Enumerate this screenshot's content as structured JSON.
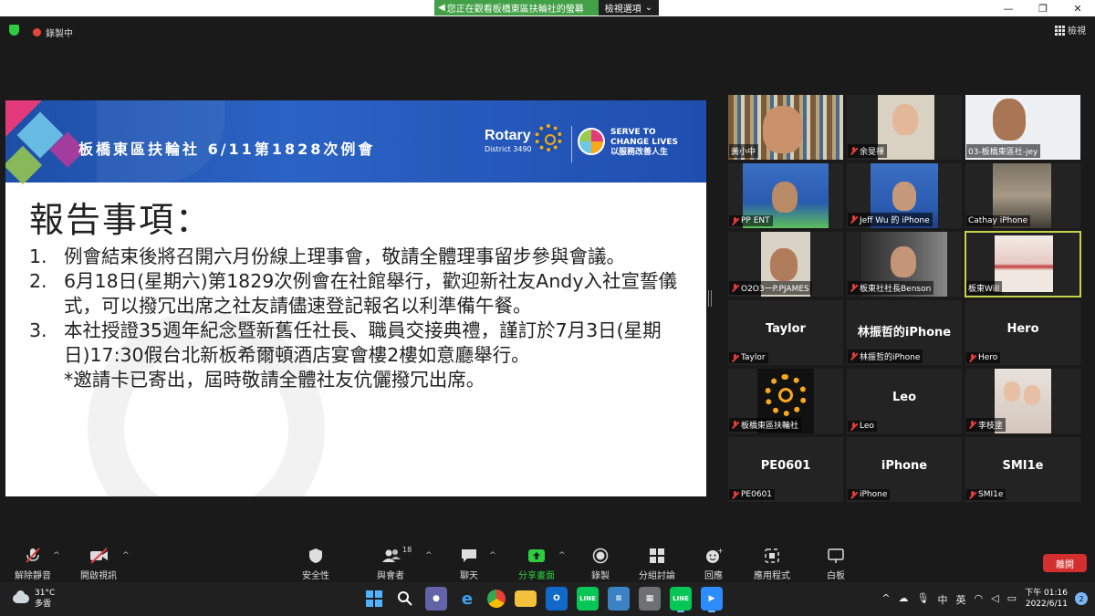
{
  "window": {
    "title": "Zoom 會議",
    "share_banner": "您正在觀看板橋東區扶輪社的螢幕",
    "view_options": "檢視選項",
    "recording": "錄製中",
    "view_button": "檢視"
  },
  "slide": {
    "title": "板橋東區扶輪社  6/11第1828次例會",
    "rotary_brand": "Rotary",
    "rotary_district": "District 3490",
    "serve_line1": "SERVE TO",
    "serve_line2": "CHANGE LIVES",
    "serve_line3": "以服務改善人生",
    "heading": "報告事項：",
    "items": [
      {
        "num": "1.",
        "text": "例會結束後將召開六月份線上理事會，敬請全體理事留步參與會議。"
      },
      {
        "num": "2.",
        "text": "6月18日(星期六)第1829次例會在社館舉行，歡迎新社友Andy入社宣誓儀式，可以撥冗出席之社友請儘速登記報名以利準備午餐。"
      },
      {
        "num": "3.",
        "text": "本社授證35週年紀念暨新舊任社長、職員交接典禮，謹訂於7月3日(星期日)17:30假台北新板希爾頓酒店宴會樓2樓如意廳舉行。"
      }
    ],
    "note": "*邀請卡已寄出，屆時敬請全體社友伉儷撥冗出席。"
  },
  "participants": [
    {
      "label": "黃小中",
      "muted": false,
      "video": "bookshelf"
    },
    {
      "label": "余旻禪",
      "muted": true,
      "video": "woman"
    },
    {
      "label": "03-板橋東區社-jey",
      "muted": false,
      "video": "man-light"
    },
    {
      "label": "PP ENT",
      "muted": true,
      "video": "backdrop"
    },
    {
      "label": "Jeff Wu 的 iPhone",
      "muted": true,
      "video": "backdrop"
    },
    {
      "label": "Cathay iPhone",
      "muted": false,
      "video": "room"
    },
    {
      "label": "O2O3一P.PJAMES",
      "muted": true,
      "video": "man-light"
    },
    {
      "label": "板東社社長Benson",
      "muted": true,
      "video": "car"
    },
    {
      "label": "板東Will",
      "muted": false,
      "video": "stage",
      "active": true
    },
    {
      "label": "Taylor",
      "muted": true,
      "name_display": "Taylor"
    },
    {
      "label": "林振哲的iPhone",
      "muted": true,
      "name_display": "林振哲的iPhone"
    },
    {
      "label": "Hero",
      "muted": true,
      "name_display": "Hero"
    },
    {
      "label": "板橋東區扶輪社",
      "muted": true,
      "video": "rotary-logo"
    },
    {
      "label": "Leo",
      "muted": true,
      "name_display": "Leo"
    },
    {
      "label": "李枝塗",
      "muted": true,
      "video": "kids"
    },
    {
      "label": "PE0601",
      "muted": true,
      "name_display": "PE0601"
    },
    {
      "label": "iPhone",
      "muted": true,
      "name_display": "iPhone"
    },
    {
      "label": "SMI1e",
      "muted": true,
      "name_display": "SMI1e"
    }
  ],
  "toolbar": {
    "unmute": "解除靜音",
    "start_video": "開啟視訊",
    "security": "安全性",
    "participants": "與會者",
    "participants_count": "18",
    "chat": "聊天",
    "share_screen": "分享畫面",
    "record": "錄製",
    "breakout": "分組討論",
    "reactions": "回應",
    "apps": "應用程式",
    "whiteboard": "白板",
    "leave": "離開"
  },
  "taskbar": {
    "temperature": "31°C",
    "weather": "多雲",
    "ime": "中",
    "ime2": "英",
    "time": "下午 01:16",
    "date": "2022/6/11",
    "notifications": "2"
  },
  "colors": {
    "accent_green": "#2ecc40",
    "leave_red": "#d32f2f",
    "active_speaker": "#c3d449",
    "slide_header_blue": "#1d4fa8"
  }
}
